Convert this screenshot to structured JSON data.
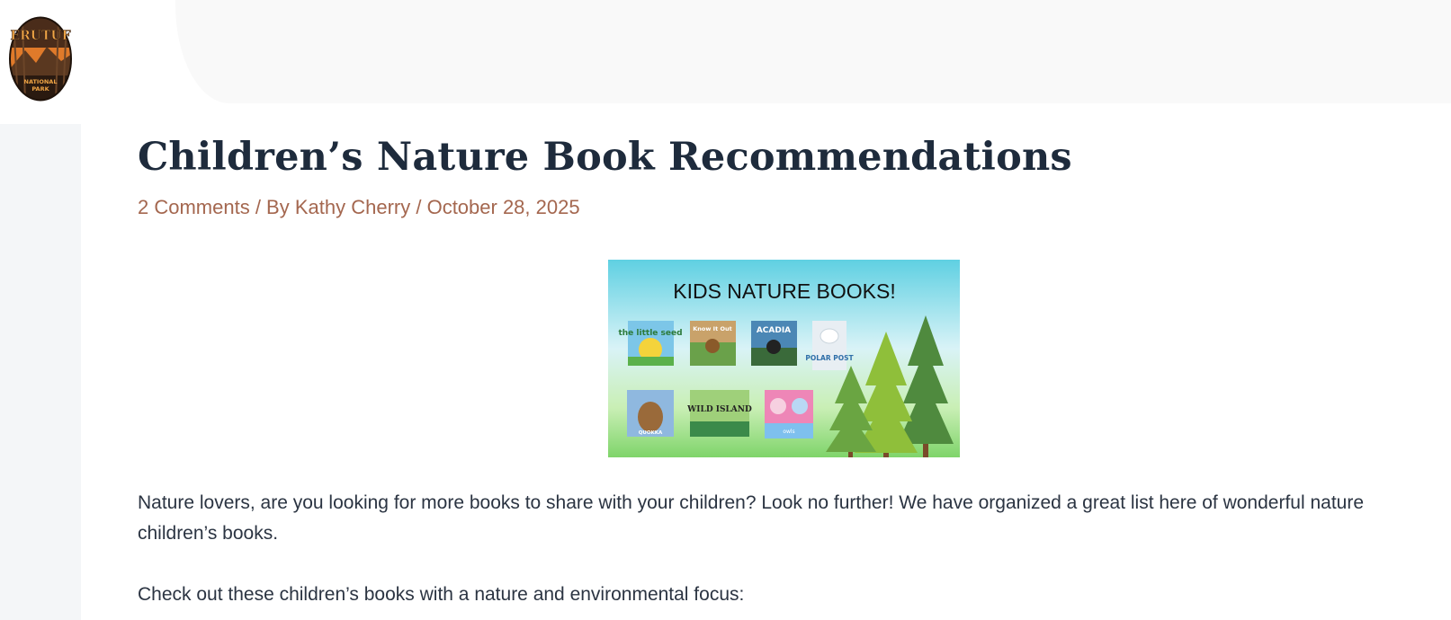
{
  "site": {
    "logo_text_top": "ERUTUF",
    "logo_text_bottom_1": "NATIONAL",
    "logo_text_bottom_2": "PARK"
  },
  "post": {
    "title": "Children’s Nature Book Recommendations",
    "meta": {
      "comments": "2 Comments",
      "sep1": " / By ",
      "author": "Kathy Cherry",
      "sep2": " / ",
      "date": "October 28, 2025"
    },
    "featured_image": {
      "heading": "KIDS NATURE BOOKS!",
      "books_row1": [
        "the little seed",
        "Know It Out",
        "ACADIA",
        "POLAR POST"
      ],
      "books_row2": [
        "QUOKKA",
        "WILD ISLAND",
        "owls"
      ]
    },
    "paragraphs": [
      "Nature lovers, are you looking for more books to share with your children? Look no further! We have organized a great list here of wonderful nature children’s books.",
      "Check out these children’s books with a nature and environmental focus:"
    ]
  },
  "colors": {
    "title": "#1e2b3c",
    "meta": "#a4674f",
    "body_text": "#2b3442"
  }
}
